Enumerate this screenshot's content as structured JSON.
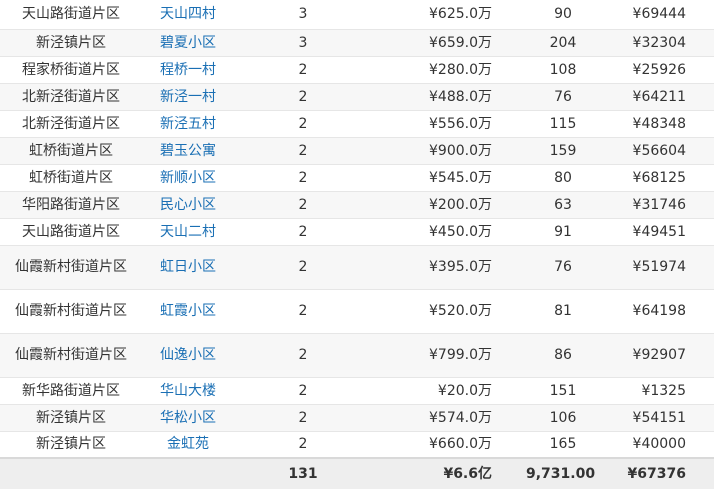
{
  "rows": [
    {
      "district": "天山路街道片区",
      "community": "天山四村",
      "count": "3",
      "price": "¥625.0万",
      "area": "90",
      "unit_price": "¥69444"
    },
    {
      "district": "新泾镇片区",
      "community": "碧夏小区",
      "count": "3",
      "price": "¥659.0万",
      "area": "204",
      "unit_price": "¥32304"
    },
    {
      "district": "程家桥街道片区",
      "community": "程桥一村",
      "count": "2",
      "price": "¥280.0万",
      "area": "108",
      "unit_price": "¥25926"
    },
    {
      "district": "北新泾街道片区",
      "community": "新泾一村",
      "count": "2",
      "price": "¥488.0万",
      "area": "76",
      "unit_price": "¥64211"
    },
    {
      "district": "北新泾街道片区",
      "community": "新泾五村",
      "count": "2",
      "price": "¥556.0万",
      "area": "115",
      "unit_price": "¥48348"
    },
    {
      "district": "虹桥街道片区",
      "community": "碧玉公寓",
      "count": "2",
      "price": "¥900.0万",
      "area": "159",
      "unit_price": "¥56604"
    },
    {
      "district": "虹桥街道片区",
      "community": "新顺小区",
      "count": "2",
      "price": "¥545.0万",
      "area": "80",
      "unit_price": "¥68125"
    },
    {
      "district": "华阳路街道片区",
      "community": "民心小区",
      "count": "2",
      "price": "¥200.0万",
      "area": "63",
      "unit_price": "¥31746"
    },
    {
      "district": "天山路街道片区",
      "community": "天山二村",
      "count": "2",
      "price": "¥450.0万",
      "area": "91",
      "unit_price": "¥49451"
    },
    {
      "district": "仙霞新村街道片区",
      "community": "虹日小区",
      "count": "2",
      "price": "¥395.0万",
      "area": "76",
      "unit_price": "¥51974"
    },
    {
      "district": "仙霞新村街道片区",
      "community": "虹霞小区",
      "count": "2",
      "price": "¥520.0万",
      "area": "81",
      "unit_price": "¥64198"
    },
    {
      "district": "仙霞新村街道片区",
      "community": "仙逸小区",
      "count": "2",
      "price": "¥799.0万",
      "area": "86",
      "unit_price": "¥92907"
    },
    {
      "district": "新华路街道片区",
      "community": "华山大楼",
      "count": "2",
      "price": "¥20.0万",
      "area": "151",
      "unit_price": "¥1325"
    },
    {
      "district": "新泾镇片区",
      "community": "华松小区",
      "count": "2",
      "price": "¥574.0万",
      "area": "106",
      "unit_price": "¥54151"
    },
    {
      "district": "新泾镇片区",
      "community": "金虹苑",
      "count": "2",
      "price": "¥660.0万",
      "area": "165",
      "unit_price": "¥40000"
    }
  ],
  "totals": {
    "count": "131",
    "price": "¥6.6亿",
    "area": "9,731.00",
    "unit_price": "¥67376"
  },
  "colors": {
    "link": "#1a6fb4",
    "stripe": "#f7f7f7",
    "total_bg": "#eeeeee"
  }
}
